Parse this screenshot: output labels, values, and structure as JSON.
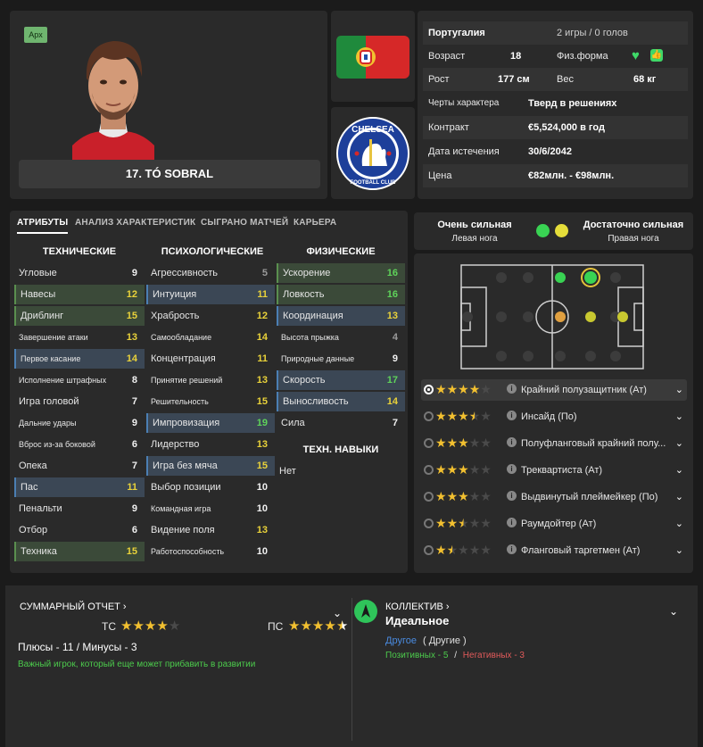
{
  "player": {
    "badge": "Арх",
    "name": "17. TÓ SOBRAL"
  },
  "info": {
    "nationality": "Португалия",
    "caps": "2 игры / 0 голов",
    "age_label": "Возраст",
    "age": "18",
    "fitness_label": "Физ.форма",
    "height_label": "Рост",
    "height": "177 см",
    "weight_label": "Вес",
    "weight": "68 кг",
    "personality_label": "Черты характера",
    "personality": "Тверд в решениях",
    "contract_label": "Контракт",
    "contract": "€5,524,000 в год",
    "expiry_label": "Дата истечения",
    "expiry": "30/6/2042",
    "value_label": "Цена",
    "value": "€82млн. - €98млн."
  },
  "tabs": [
    "АТРИБУТЫ",
    "АНАЛИЗ ХАРАКТЕРИСТИК",
    "СЫГРАНО МАТЧЕЙ",
    "КАРЬЕРА"
  ],
  "attributes": {
    "technical_title": "ТЕХНИЧЕСКИЕ",
    "mental_title": "ПСИХОЛОГИЧЕСКИЕ",
    "physical_title": "ФИЗИЧЕСКИЕ",
    "skills_title": "ТЕХН. НАВЫКИ",
    "skills_value": "Нет",
    "technical": [
      {
        "label": "Угловые",
        "value": "9",
        "hl": "",
        "color": "white"
      },
      {
        "label": "Навесы",
        "value": "12",
        "hl": "green",
        "color": "yellow"
      },
      {
        "label": "Дриблинг",
        "value": "15",
        "hl": "green",
        "color": "yellow"
      },
      {
        "label": "Завершение атаки",
        "value": "13",
        "hl": "",
        "color": "yellow",
        "small": true
      },
      {
        "label": "Первое касание",
        "value": "14",
        "hl": "blue",
        "color": "yellow",
        "small": true
      },
      {
        "label": "Исполнение штрафных",
        "value": "8",
        "hl": "",
        "color": "white",
        "small": true
      },
      {
        "label": "Игра головой",
        "value": "7",
        "hl": "",
        "color": "white"
      },
      {
        "label": "Дальние удары",
        "value": "9",
        "hl": "",
        "color": "white",
        "small": true
      },
      {
        "label": "Вброс из-за боковой",
        "value": "6",
        "hl": "",
        "color": "white",
        "small": true
      },
      {
        "label": "Опека",
        "value": "7",
        "hl": "",
        "color": "white"
      },
      {
        "label": "Пас",
        "value": "11",
        "hl": "blue",
        "color": "yellow"
      },
      {
        "label": "Пенальти",
        "value": "9",
        "hl": "",
        "color": "white"
      },
      {
        "label": "Отбор",
        "value": "6",
        "hl": "",
        "color": "white"
      },
      {
        "label": "Техника",
        "value": "15",
        "hl": "green",
        "color": "yellow"
      }
    ],
    "mental": [
      {
        "label": "Агрессивность",
        "value": "5",
        "hl": "",
        "color": "grey"
      },
      {
        "label": "Интуиция",
        "value": "11",
        "hl": "blue",
        "color": "yellow"
      },
      {
        "label": "Храбрость",
        "value": "12",
        "hl": "",
        "color": "yellow"
      },
      {
        "label": "Самообладание",
        "value": "14",
        "hl": "",
        "color": "yellow",
        "small": true
      },
      {
        "label": "Концентрация",
        "value": "11",
        "hl": "",
        "color": "yellow"
      },
      {
        "label": "Принятие решений",
        "value": "13",
        "hl": "",
        "color": "yellow",
        "small": true
      },
      {
        "label": "Решительность",
        "value": "15",
        "hl": "",
        "color": "yellow",
        "small": true
      },
      {
        "label": "Импровизация",
        "value": "19",
        "hl": "blue",
        "color": "green"
      },
      {
        "label": "Лидерство",
        "value": "13",
        "hl": "",
        "color": "yellow"
      },
      {
        "label": "Игра без мяча",
        "value": "15",
        "hl": "blue",
        "color": "yellow"
      },
      {
        "label": "Выбор позиции",
        "value": "10",
        "hl": "",
        "color": "white"
      },
      {
        "label": "Командная игра",
        "value": "10",
        "hl": "",
        "color": "white",
        "small": true
      },
      {
        "label": "Видение поля",
        "value": "13",
        "hl": "",
        "color": "yellow"
      },
      {
        "label": "Работоспособность",
        "value": "10",
        "hl": "",
        "color": "white",
        "small": true
      }
    ],
    "physical": [
      {
        "label": "Ускорение",
        "value": "16",
        "hl": "green",
        "color": "green"
      },
      {
        "label": "Ловкость",
        "value": "16",
        "hl": "green",
        "color": "green"
      },
      {
        "label": "Координация",
        "value": "13",
        "hl": "blue",
        "color": "yellow"
      },
      {
        "label": "Высота прыжка",
        "value": "4",
        "hl": "",
        "color": "grey",
        "small": true
      },
      {
        "label": "Природные данные",
        "value": "9",
        "hl": "",
        "color": "white",
        "small": true
      },
      {
        "label": "Скорость",
        "value": "17",
        "hl": "blue",
        "color": "green"
      },
      {
        "label": "Выносливость",
        "value": "14",
        "hl": "blue",
        "color": "yellow"
      },
      {
        "label": "Сила",
        "value": "7",
        "hl": "",
        "color": "white"
      }
    ]
  },
  "feet": {
    "left_level": "Очень сильная",
    "left_label": "Левая нога",
    "right_level": "Достаточно сильная",
    "right_label": "Правая нога",
    "left_color": "#39d353",
    "right_color": "#e5dd3a"
  },
  "roles": [
    {
      "name": "Крайний полузащитник (Ат)",
      "stars": 4,
      "selected": true
    },
    {
      "name": "Инсайд (По)",
      "stars": 3.5,
      "selected": false
    },
    {
      "name": "Полуфланговый крайний полу...",
      "stars": 3,
      "selected": false
    },
    {
      "name": "Треквартиста (Ат)",
      "stars": 3,
      "selected": false
    },
    {
      "name": "Выдвинутый плеймейкер (По)",
      "stars": 3,
      "selected": false
    },
    {
      "name": "Раумдойтер (Ат)",
      "stars": 2.5,
      "selected": false
    },
    {
      "name": "Фланговый таргетмен (Ат)",
      "stars": 1.5,
      "selected": false
    }
  ],
  "report": {
    "title": "СУММАРНЫЙ ОТЧЕТ",
    "ca_label": "ТС",
    "ca_stars": 4,
    "pa_label": "ПС",
    "pa_stars": 4.5,
    "pros_cons": "Плюсы - 11 / Минусы - 3",
    "note": "Важный игрок, который еще может прибавить в развитии"
  },
  "team": {
    "title": "КОЛЛЕКТИВ",
    "status": "Идеальное",
    "other_link": "Другое",
    "other_group": "( Другие )",
    "positive": "Позитивных - 5",
    "separator": "/",
    "negative": "Негативных - 3"
  }
}
